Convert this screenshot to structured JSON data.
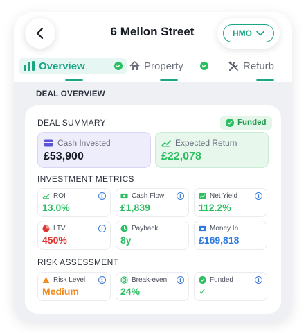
{
  "header": {
    "title": "6 Mellon Street",
    "type_selector": "HMO"
  },
  "tabs": [
    {
      "label": "Overview",
      "active": true,
      "status": "complete"
    },
    {
      "label": "Property",
      "active": false,
      "status": "complete"
    },
    {
      "label": "Refurb",
      "active": false
    }
  ],
  "section_label": "DEAL OVERVIEW",
  "deal_summary": {
    "title": "DEAL SUMMARY",
    "badge": "Funded",
    "cash_invested": {
      "label": "Cash Invested",
      "value": "£53,900"
    },
    "expected_return": {
      "label": "Expected Return",
      "value": "£22,078"
    }
  },
  "investment_metrics": {
    "title": "INVESTMENT METRICS",
    "items": [
      {
        "label": "ROI",
        "value": "13.0%"
      },
      {
        "label": "Cash Flow",
        "value": "£1,839"
      },
      {
        "label": "Net Yield",
        "value": "112.2%"
      },
      {
        "label": "LTV",
        "value": "450%"
      },
      {
        "label": "Payback",
        "value": "8y"
      },
      {
        "label": "Money In",
        "value": "£169,818"
      }
    ]
  },
  "risk_assessment": {
    "title": "RISK ASSESSMENT",
    "items": [
      {
        "label": "Risk Level",
        "value": "Medium"
      },
      {
        "label": "Break-even",
        "value": "24%"
      },
      {
        "label": "Funded",
        "value": "✓"
      }
    ]
  },
  "info_glyph": "i",
  "colors": {
    "accent": "#1aa585",
    "green": "#2cbf62",
    "red": "#e0342f",
    "blue": "#2f7be0",
    "orange": "#ef8c22",
    "purple_bg": "#eeedfc",
    "green_bg": "#e7f7ec"
  }
}
